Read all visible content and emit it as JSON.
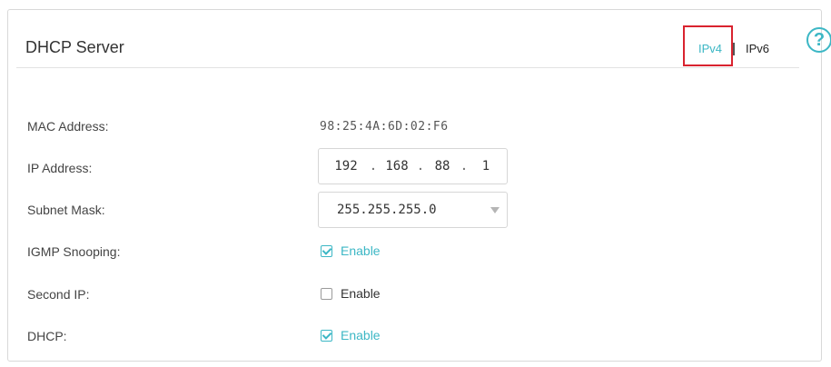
{
  "header": {
    "title": "DHCP Server",
    "tab_ipv4": "IPv4",
    "tab_ipv6": "IPv6",
    "help_icon": "question-circle-icon",
    "help_glyph": "?"
  },
  "fields": {
    "mac_label": "MAC Address:",
    "mac_value": "98:25:4A:6D:02:F6",
    "ip_label": "IP Address:",
    "ip_octets": [
      "192",
      "168",
      "88",
      "1"
    ],
    "ip_dot": ".",
    "subnet_label": "Subnet Mask:",
    "subnet_value": "255.255.255.0",
    "igmp_label": "IGMP Snooping:",
    "igmp_option": "Enable",
    "igmp_checked": true,
    "second_ip_label": "Second IP:",
    "second_ip_option": "Enable",
    "second_ip_checked": false,
    "dhcp_label": "DHCP:",
    "dhcp_option": "Enable",
    "dhcp_checked": true
  },
  "colors": {
    "accent": "#3cb7c5",
    "highlight": "#d9232f"
  }
}
